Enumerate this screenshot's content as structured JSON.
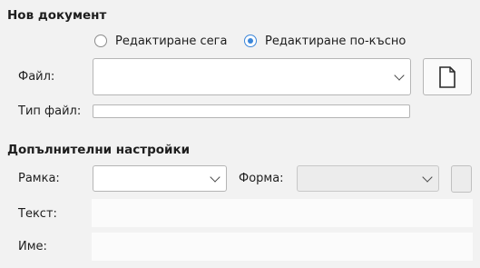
{
  "new_document": {
    "heading": "Нов документ",
    "radio_edit_now": "Редактиране сега",
    "radio_edit_later": "Редактиране по-късно",
    "selected_option": "edit_later",
    "file_label": "Файл:",
    "file_value": "",
    "file_type_label": "Тип файл:",
    "file_type_value": "",
    "new_file_icon": "document-icon"
  },
  "additional_settings": {
    "heading": "Допълнителни настройки",
    "frame_label": "Рамка:",
    "frame_value": "",
    "shape_label": "Форма:",
    "shape_value": "",
    "text_label": "Текст:",
    "text_value": "",
    "name_label": "Име:",
    "name_value": ""
  },
  "colors": {
    "accent": "#3b86d9",
    "background": "#f2f2f2"
  }
}
